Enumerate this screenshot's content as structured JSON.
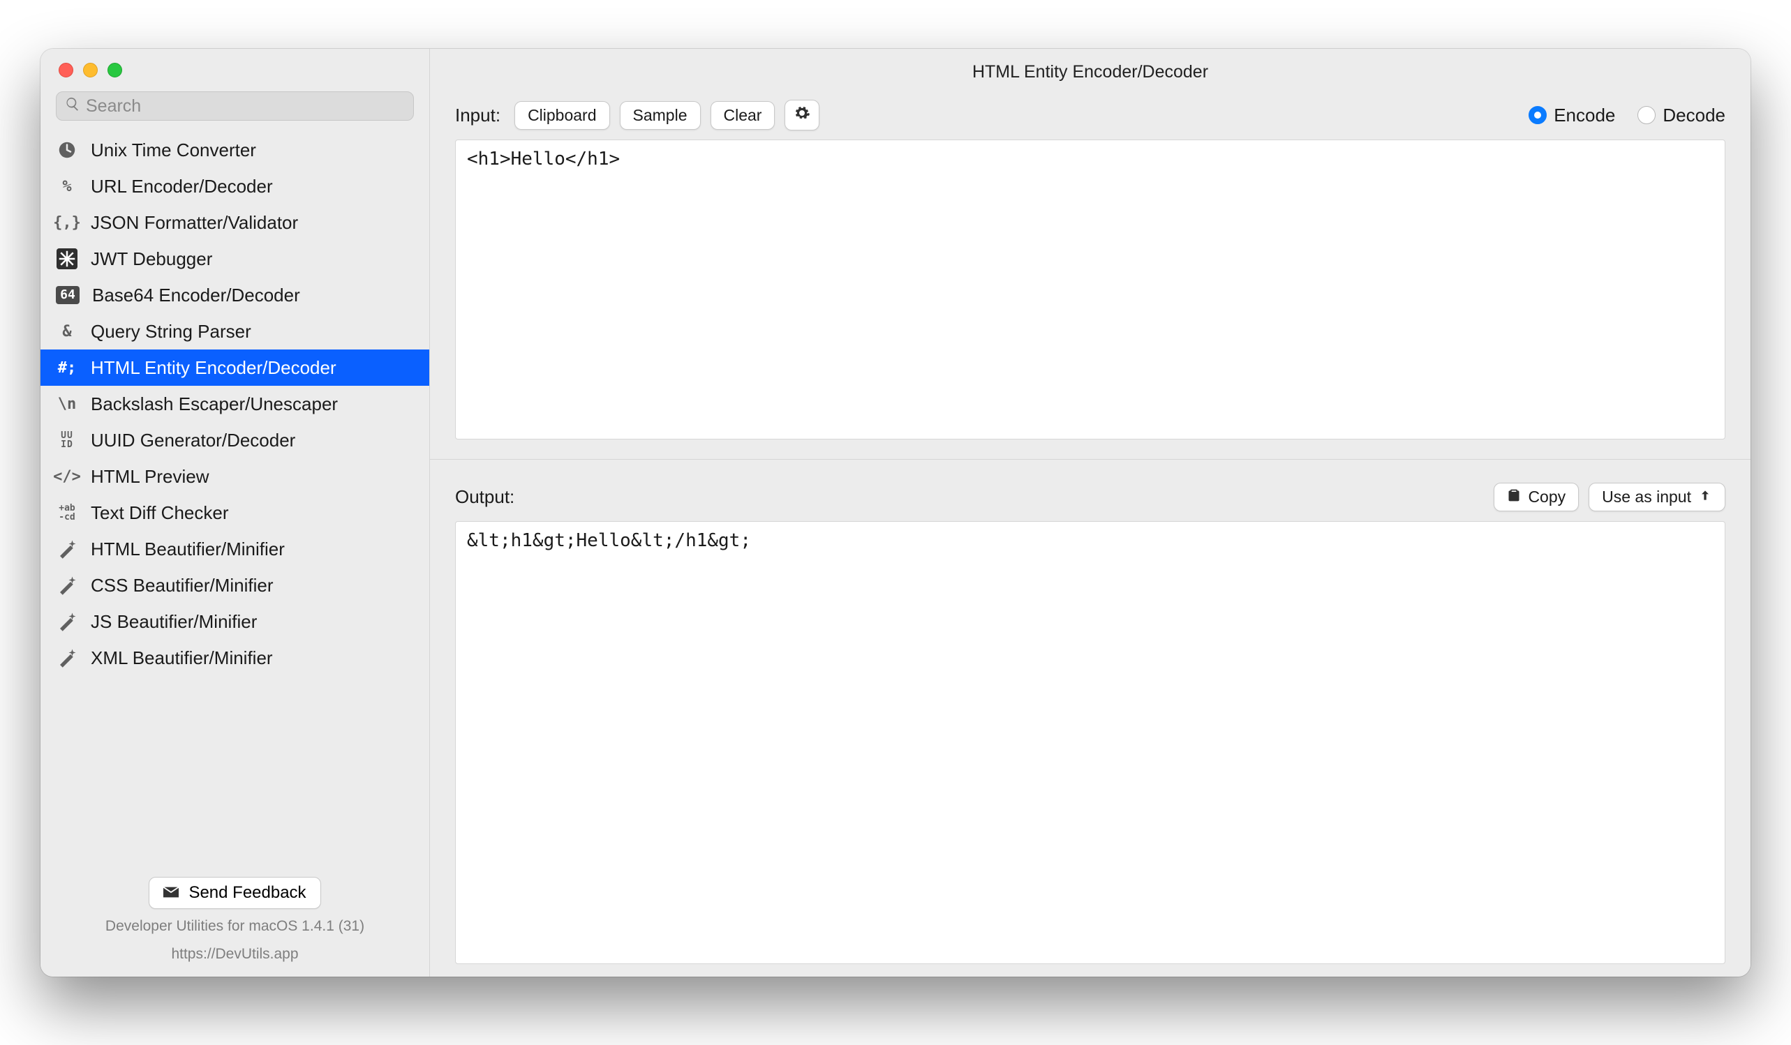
{
  "window": {
    "title": "HTML Entity Encoder/Decoder"
  },
  "search": {
    "placeholder": "Search"
  },
  "sidebar": {
    "items": [
      {
        "label": "Unix Time Converter"
      },
      {
        "label": "URL Encoder/Decoder"
      },
      {
        "label": "JSON Formatter/Validator"
      },
      {
        "label": "JWT Debugger"
      },
      {
        "label": "Base64 Encoder/Decoder"
      },
      {
        "label": "Query String Parser"
      },
      {
        "label": "HTML Entity Encoder/Decoder"
      },
      {
        "label": "Backslash Escaper/Unescaper"
      },
      {
        "label": "UUID Generator/Decoder"
      },
      {
        "label": "HTML Preview"
      },
      {
        "label": "Text Diff Checker"
      },
      {
        "label": "HTML Beautifier/Minifier"
      },
      {
        "label": "CSS Beautifier/Minifier"
      },
      {
        "label": "JS Beautifier/Minifier"
      },
      {
        "label": "XML Beautifier/Minifier"
      }
    ],
    "selected_index": 6
  },
  "footer": {
    "feedback_label": "Send Feedback",
    "line1": "Developer Utilities for macOS 1.4.1 (31)",
    "line2": "https://DevUtils.app"
  },
  "input": {
    "label": "Input:",
    "buttons": {
      "clipboard": "Clipboard",
      "sample": "Sample",
      "clear": "Clear"
    },
    "mode": {
      "encode": "Encode",
      "decode": "Decode",
      "selected": "encode"
    },
    "value": "<h1>Hello</h1>"
  },
  "output": {
    "label": "Output:",
    "buttons": {
      "copy": "Copy",
      "use_as_input": "Use as input"
    },
    "value": "&lt;h1&gt;Hello&lt;/h1&gt;"
  }
}
